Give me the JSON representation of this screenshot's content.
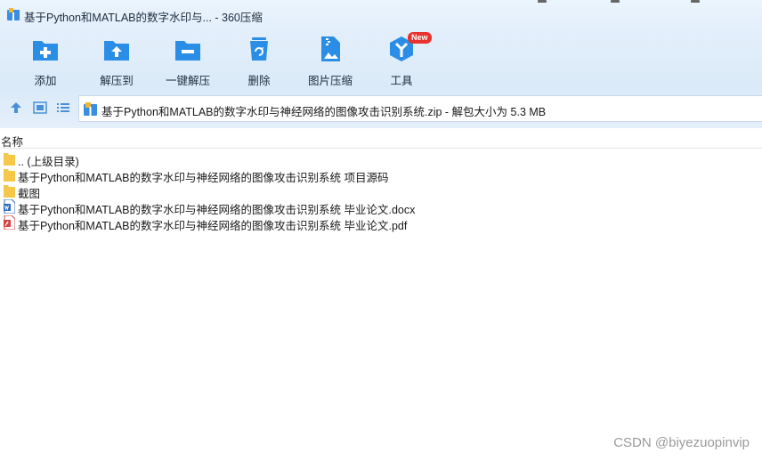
{
  "window": {
    "title": "基于Python和MATLAB的数字水印与... - 360压缩"
  },
  "toolbar": {
    "items": [
      {
        "label": "添加",
        "icon": "add-icon"
      },
      {
        "label": "解压到",
        "icon": "extract-to-icon"
      },
      {
        "label": "一键解压",
        "icon": "one-click-extract-icon"
      },
      {
        "label": "删除",
        "icon": "delete-icon"
      },
      {
        "label": "图片压缩",
        "icon": "image-compress-icon"
      },
      {
        "label": "工具",
        "icon": "tools-icon",
        "badge": "New"
      }
    ]
  },
  "navigation": {
    "path": "基于Python和MATLAB的数字水印与神经网络的图像攻击识别系统.zip - 解包大小为 5.3 MB"
  },
  "file_list": {
    "column_name": "名称",
    "rows": [
      {
        "name": ".. (上级目录)",
        "type": "folder"
      },
      {
        "name": "基于Python和MATLAB的数字水印与神经网络的图像攻击识别系统 项目源码",
        "type": "folder"
      },
      {
        "name": "截图",
        "type": "folder"
      },
      {
        "name": "基于Python和MATLAB的数字水印与神经网络的图像攻击识别系统 毕业论文.docx",
        "type": "docx"
      },
      {
        "name": "基于Python和MATLAB的数字水印与神经网络的图像攻击识别系统 毕业论文.pdf",
        "type": "pdf"
      }
    ]
  },
  "watermark": "CSDN @biyezuopinvip",
  "colors": {
    "accent": "#2b8ee6",
    "folder": "#f6c84a",
    "badge": "#e8322f"
  }
}
